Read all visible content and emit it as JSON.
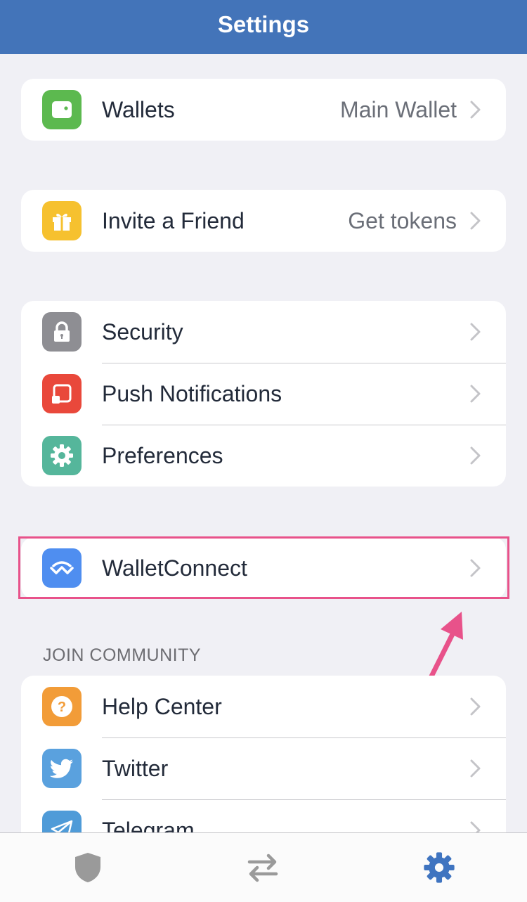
{
  "header": {
    "title": "Settings"
  },
  "wallets": {
    "label": "Wallets",
    "value": "Main Wallet",
    "icon": "wallet-icon",
    "color": "#5cb94f"
  },
  "invite": {
    "label": "Invite a Friend",
    "value": "Get tokens",
    "icon": "gift-icon",
    "color": "#f6c12f"
  },
  "settings_group": [
    {
      "label": "Security",
      "icon": "lock-icon",
      "color": "#8e8e93"
    },
    {
      "label": "Push Notifications",
      "icon": "notification-icon",
      "color": "#e9483b"
    },
    {
      "label": "Preferences",
      "icon": "gear-icon",
      "color": "#55b69b"
    }
  ],
  "walletconnect": {
    "label": "WalletConnect",
    "icon": "walletconnect-icon",
    "color": "#4f8ef0"
  },
  "community": {
    "heading": "JOIN COMMUNITY",
    "items": [
      {
        "label": "Help Center",
        "icon": "question-icon",
        "color": "#f29c38"
      },
      {
        "label": "Twitter",
        "icon": "twitter-icon",
        "color": "#5aa1de"
      },
      {
        "label": "Telegram",
        "icon": "telegram-icon",
        "color": "#4f9bd8"
      }
    ]
  },
  "tabbar": {
    "tabs": [
      {
        "name": "wallet-tab",
        "icon": "shield-icon",
        "active": false
      },
      {
        "name": "dapps-tab",
        "icon": "swap-arrows-icon",
        "active": false
      },
      {
        "name": "settings-tab",
        "icon": "gear-icon",
        "active": true
      }
    ],
    "active_color": "#3f74c0",
    "inactive_color": "#9a9a9a"
  },
  "annotation": {
    "highlight_color": "#e8528a"
  }
}
